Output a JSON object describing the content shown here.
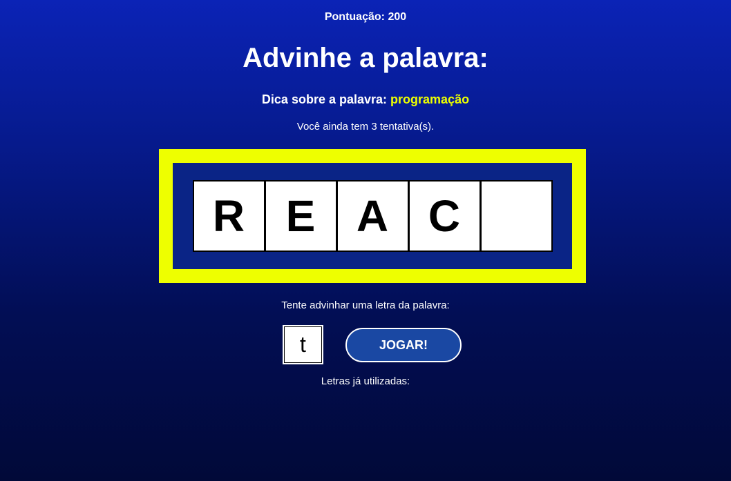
{
  "score": {
    "label": "Pontuação:",
    "value": "200"
  },
  "title": "Advinhe a palavra:",
  "hint": {
    "label": "Dica sobre a palavra:",
    "value": "programação"
  },
  "attempts": {
    "prefix": "Você ainda tem",
    "count": "3",
    "suffix": "tentativa(s)."
  },
  "word": {
    "letters": [
      "R",
      "E",
      "A",
      "C",
      ""
    ]
  },
  "guess": {
    "prompt": "Tente advinhar uma letra da palavra:",
    "input_value": "t",
    "button_label": "JOGAR!"
  },
  "used_letters": {
    "label": "Letras já utilizadas:",
    "letters": ""
  },
  "colors": {
    "accent_yellow": "#eeff00",
    "button_blue": "#1a48a3",
    "board_blue": "#0a2486"
  }
}
